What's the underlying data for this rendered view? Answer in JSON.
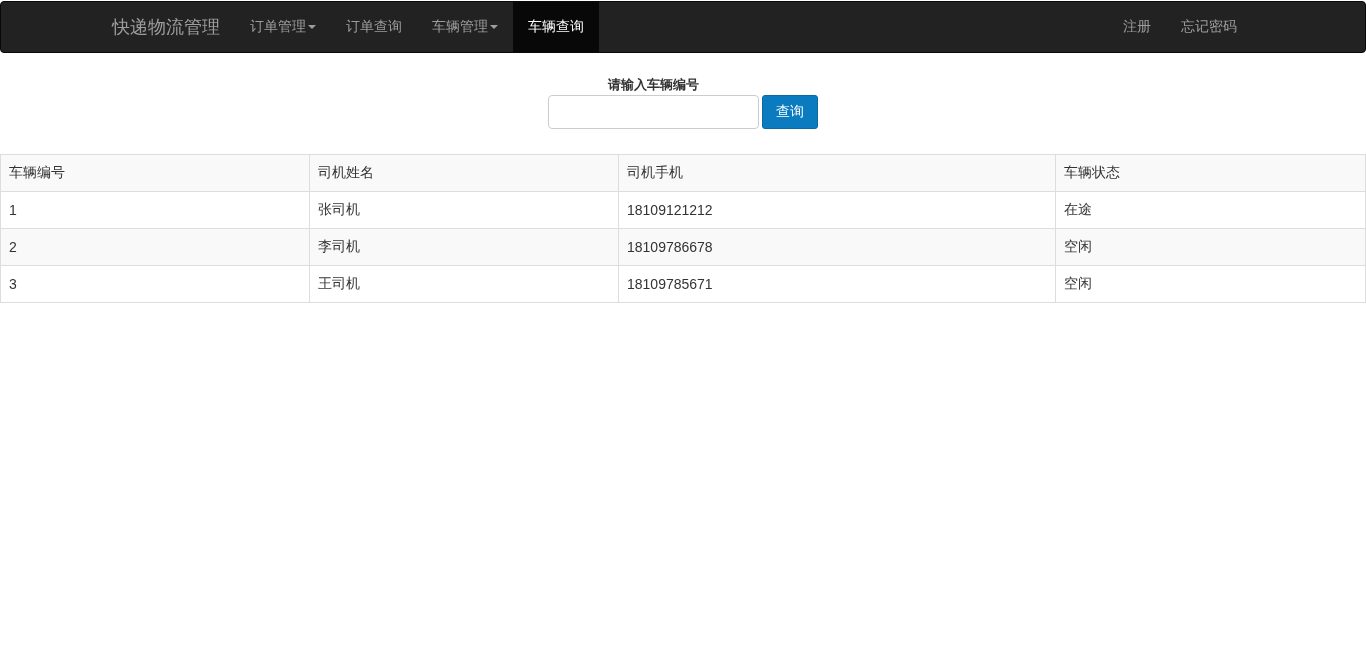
{
  "navbar": {
    "brand": "快递物流管理",
    "items": [
      {
        "label": "订单管理",
        "dropdown": true,
        "selected": false
      },
      {
        "label": "订单查询",
        "dropdown": false,
        "selected": false
      },
      {
        "label": "车辆管理",
        "dropdown": true,
        "selected": false
      },
      {
        "label": "车辆查询",
        "dropdown": false,
        "selected": true
      }
    ],
    "right_items": [
      "注册",
      "忘记密码"
    ]
  },
  "search": {
    "label": "请输入车辆编号",
    "button": "查询"
  },
  "table": {
    "columns": [
      "车辆编号",
      "司机姓名",
      "司机手机",
      "车辆状态"
    ],
    "rows": [
      [
        "1",
        "张司机",
        "18109121212",
        "在途"
      ],
      [
        "2",
        "李司机",
        "18109786678",
        "空闲"
      ],
      [
        "3",
        "王司机",
        "18109785671",
        "空闲"
      ]
    ]
  }
}
